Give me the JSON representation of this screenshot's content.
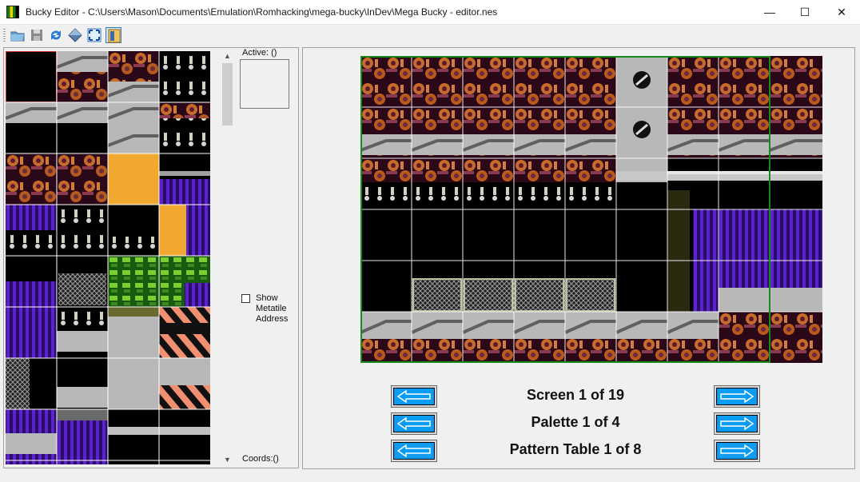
{
  "window": {
    "title": "Bucky Editor - C:\\Users\\Mason\\Documents\\Emulation\\Romhacking\\mega-bucky\\InDev\\Mega Bucky - editor.nes",
    "minimize_glyph": "—",
    "maximize_glyph": "☐",
    "close_glyph": "✕"
  },
  "toolbar": {
    "buttons": [
      {
        "name": "open-folder-icon",
        "checked": false
      },
      {
        "name": "save-disk-icon",
        "checked": false
      },
      {
        "name": "refresh-icon",
        "checked": false
      },
      {
        "name": "diamond-icon",
        "checked": false
      },
      {
        "name": "fullscreen-icon",
        "checked": false
      },
      {
        "name": "properties-icon",
        "checked": true
      }
    ]
  },
  "tile_panel": {
    "active_label": "Active: ()",
    "show_metatile_label": "Show Metatile Address",
    "show_metatile_checked": false,
    "coords_label": "Coords:()",
    "scroll_up_glyph": "▲",
    "scroll_down_glyph": "▼"
  },
  "screen_panel": {
    "screen_label": "Screen 1 of 19",
    "palette_label": "Palette 1 of 4",
    "pattern_label": "Pattern Table 1 of 8"
  },
  "colors": {
    "accent_blue": "#0a9bf5",
    "grid_green": "#1a8a1a",
    "pipe_orange": "#c86a28",
    "wall_purple": "#5a24c8",
    "metal_gray": "#b8b8b8",
    "sand_orange": "#f0a830"
  }
}
